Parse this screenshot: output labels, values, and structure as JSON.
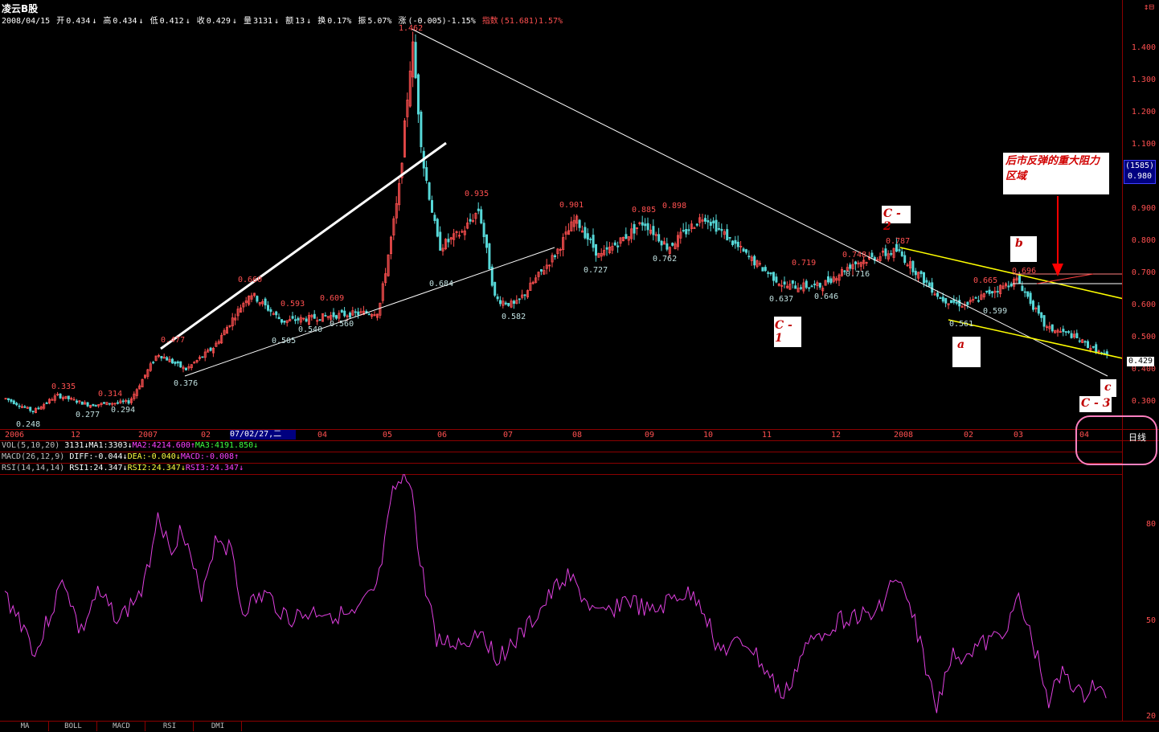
{
  "window": {
    "title": "凌云B股",
    "close_icon": "↕⊟"
  },
  "info": {
    "date": "2008/04/15",
    "open_label": "开",
    "open": "0.434",
    "high_label": "高",
    "high": "0.434",
    "low_label": "低",
    "low": "0.412",
    "close_label": "收",
    "close": "0.429",
    "volume_label": "量",
    "volume": "3131",
    "amount_label": "额",
    "amount": "13",
    "turnover_label": "换",
    "turnover": "0.17%",
    "amplitude_label": "振",
    "amplitude": "5.07%",
    "change_label": "涨",
    "change": "(-0.005)-1.15%",
    "index_label": "指数",
    "index": "(51.681)1.57%"
  },
  "price_axis": {
    "ticks": [
      "1.400",
      "1.300",
      "1.200",
      "1.100",
      "1.000",
      "0.900",
      "0.800",
      "0.700",
      "0.600",
      "0.500",
      "0.400",
      "0.300"
    ],
    "cursor_value": "(1585)",
    "cursor_price": "0.980",
    "current_price": "0.429"
  },
  "time_axis": {
    "labels": [
      "2006",
      "12",
      "2007",
      "02",
      "04",
      "05",
      "06",
      "07",
      "08",
      "09",
      "10",
      "11",
      "12",
      "2008",
      "02",
      "03",
      "04"
    ],
    "cursor": "07/02/27,二"
  },
  "price_labels": [
    "1.462",
    "0.935",
    "0.901",
    "0.885",
    "0.898",
    "0.787",
    "0.748",
    "0.719",
    "0.716",
    "0.762",
    "0.727",
    "0.684",
    "0.582",
    "0.637",
    "0.646",
    "0.696",
    "0.665",
    "0.599",
    "0.561",
    "0.660",
    "0.593",
    "0.609",
    "0.540",
    "0.560",
    "0.505",
    "0.477",
    "0.376",
    "0.335",
    "0.314",
    "0.294",
    "0.277",
    "0.248"
  ],
  "indicators": {
    "vol": {
      "name": "VOL(5,10,20)",
      "value": "3131",
      "ma1": "MA1:3303",
      "ma2": "MA2:4214.600",
      "ma3": "MA3:4191.850"
    },
    "macd": {
      "name": "MACD(26,12,9)",
      "diff": "DIFF:-0.044",
      "dea": "DEA:-0.040",
      "macd": "MACD:-0.008"
    },
    "rsi": {
      "name": "RSI(14,14,14)",
      "rsi1": "RSI1:24.347",
      "rsi2": "RSI2:24.347",
      "rsi3": "RSI3:24.347"
    }
  },
  "rsi_axis": {
    "ticks": [
      "80",
      "50",
      "20"
    ]
  },
  "annotations": {
    "callout": "后市反弹的重大阻力区域",
    "c1": "C - 1",
    "c2": "C - 2",
    "c3": "C - 3",
    "a": "a",
    "b": "b",
    "c": "c"
  },
  "period_label": "日线",
  "tabs": [
    "MA",
    "BOLL",
    "MACD",
    "RSI",
    "DMI"
  ],
  "colors": {
    "up": "#ff5050",
    "down": "#56d8d8",
    "grid": "#8b0000",
    "rsi": "#e040e0",
    "trend_yellow": "#ffff00"
  }
}
